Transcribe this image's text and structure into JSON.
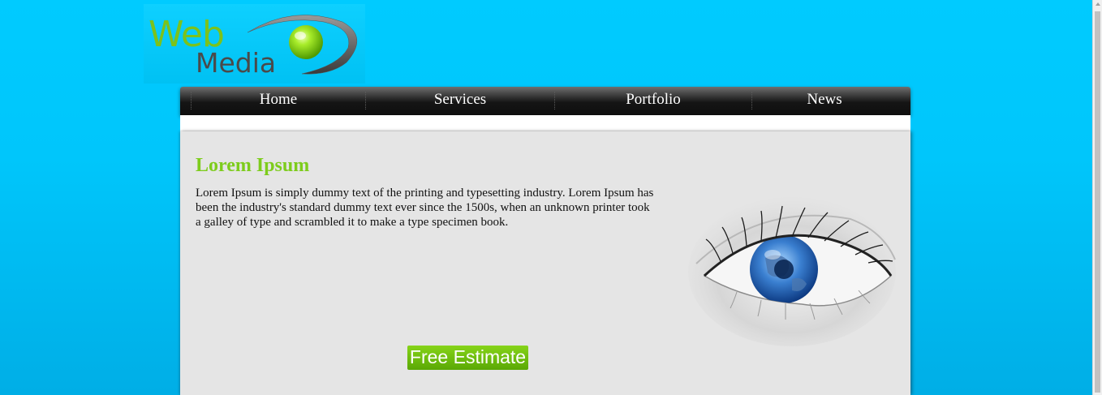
{
  "logo": {
    "text_web": "Web",
    "text_media": "Media",
    "icon": "eye-orb-icon"
  },
  "nav": {
    "items": [
      {
        "label": "Home"
      },
      {
        "label": "Services"
      },
      {
        "label": "Portfolio"
      },
      {
        "label": "News"
      }
    ]
  },
  "main": {
    "heading": "Lorem Ipsum",
    "paragraph": "Lorem Ipsum is simply dummy text of the printing and typesetting industry. Lorem Ipsum has been the industry's standard dummy text ever since the 1500s, when an unknown printer took a galley of type and scrambled it to make a type specimen book.",
    "cta_label": "Free Estimate",
    "image": "eye-with-globe-image"
  },
  "colors": {
    "page_background": "#00c6fb",
    "accent_green": "#7dcc1c",
    "nav_background": "#1a1a1a",
    "content_background": "#e5e5e5"
  }
}
